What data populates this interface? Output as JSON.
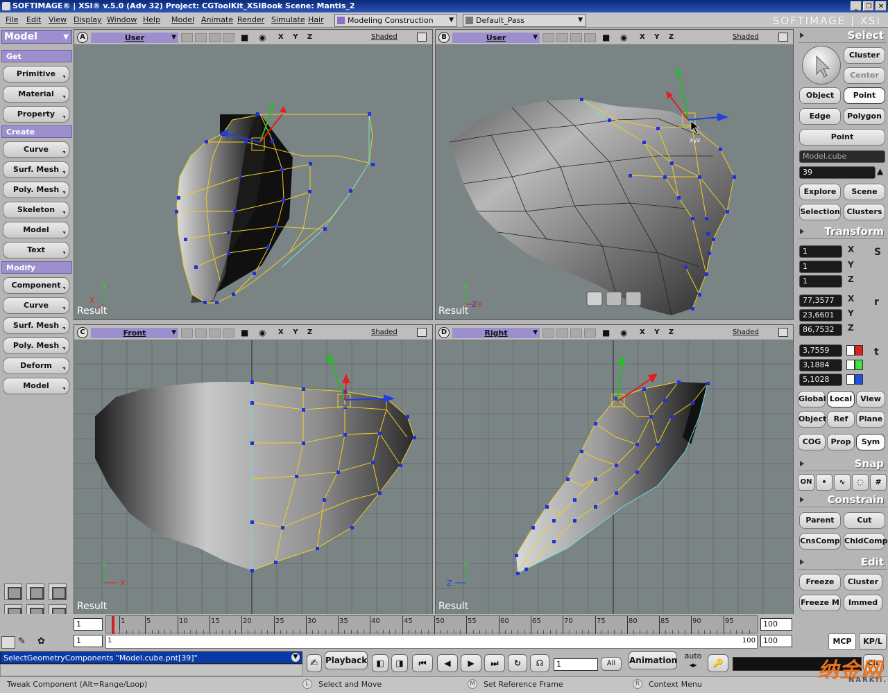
{
  "title": "SOFTIMAGE® | XSI® v.5.0 (Adv 32) Project: CGToolKit_XSIBook     Scene: Mantis_2",
  "brand": "SOFTIMAGE | XSI",
  "menus": [
    "File",
    "Edit",
    "View",
    "Display",
    "Window",
    "Help",
    "Model",
    "Animate",
    "Render",
    "Simulate",
    "Hair"
  ],
  "mode_combo": "Modeling Construction Mode",
  "pass_combo": "Default_Pass",
  "left_panel": {
    "module": "Model",
    "get_label": "Get",
    "get_items": [
      "Primitive",
      "Material",
      "Property"
    ],
    "create_label": "Create",
    "create_items": [
      "Curve",
      "Surf. Mesh",
      "Poly. Mesh",
      "Skeleton",
      "Model",
      "Text"
    ],
    "modify_label": "Modify",
    "modify_items": [
      "Component",
      "Curve",
      "Surf. Mesh",
      "Poly. Mesh",
      "Deform",
      "Model"
    ]
  },
  "viewports": [
    {
      "id": "A",
      "camera": "User",
      "xyz": "X Y Z",
      "shading": "Shaded",
      "footer": "Result"
    },
    {
      "id": "B",
      "camera": "User",
      "xyz": "X Y Z",
      "shading": "Shaded",
      "footer": "Result"
    },
    {
      "id": "C",
      "camera": "Front",
      "xyz": "X Y Z",
      "shading": "Shaded",
      "footer": "Result"
    },
    {
      "id": "D",
      "camera": "Right",
      "xyz": "X Y Z",
      "shading": "Shaded",
      "footer": "Result"
    }
  ],
  "axis_labels": {
    "x": "X",
    "y": "Y",
    "z": "Z",
    "xyz": "xyz"
  },
  "right_panel": {
    "select_label": "Select",
    "cluster": "Cluster",
    "center": "Center",
    "object": "Object",
    "point": "Point",
    "edge": "Edge",
    "polygon": "Polygon",
    "point_filter": "Point",
    "selection_name": "Model.cube",
    "selection_index": "39",
    "explore": "Explore",
    "scene": "Scene",
    "selection": "Selection",
    "clusters": "Clusters",
    "transform_label": "Transform",
    "scale": [
      "1",
      "1",
      "1"
    ],
    "scale_key": "S",
    "rotate": [
      "77,3577",
      "23,6601",
      "86,7532"
    ],
    "rotate_key": "r",
    "translate": [
      "3,7559",
      "3,1884",
      "5,1028"
    ],
    "translate_key": "t",
    "global": "Global",
    "local": "Local",
    "view": "View",
    "object_ref": "Object",
    "ref": "Ref",
    "plane": "Plane",
    "cog": "COG",
    "prop": "Prop",
    "sym": "Sym",
    "snap_label": "Snap",
    "snap_on": "ON",
    "constrain_label": "Constrain",
    "parent": "Parent",
    "cut": "Cut",
    "cnscomp": "CnsComp",
    "chldcomp": "ChldComp",
    "edit_label": "Edit",
    "freeze": "Freeze",
    "edit_cluster": "Cluster",
    "freeze_m": "Freeze M",
    "immed": "Immed",
    "mcp": "MCP",
    "kpl": "KP/L"
  },
  "timeline": {
    "start_field": "1",
    "start_field2": "1",
    "range_start": "1",
    "end_value": "100",
    "end_field": "100",
    "end_field2": "100",
    "labels": [
      "1",
      "5",
      "10",
      "15",
      "20",
      "25",
      "30",
      "35",
      "40",
      "45",
      "50",
      "55",
      "60",
      "65",
      "70",
      "75",
      "80",
      "85",
      "90",
      "95"
    ],
    "current_frame": 1
  },
  "command_line": "SelectGeometryComponents \"Model.cube.pnt[39]\"",
  "playback": {
    "label": "Playback",
    "frame": "1",
    "all": "All",
    "animation": "Animation",
    "auto": "auto",
    "clr": "Clr"
  },
  "status": {
    "hint": "Tweak Component  (Alt=Range/Loop)",
    "left_key": "L",
    "left_action": "Select and Move",
    "middle_key": "M",
    "middle_action": "Set Reference Frame",
    "right_key": "R",
    "right_action": "Context Menu"
  },
  "watermark": "纳金网",
  "watermark_sub": "NARKii.COM",
  "colors": {
    "accent_purple": "#9d8fce",
    "title_blue": "#1a3f9a",
    "wire_yellow": "#f0d020",
    "vertex_blue": "#2030e0",
    "viewport_bg": "#7b8485"
  }
}
